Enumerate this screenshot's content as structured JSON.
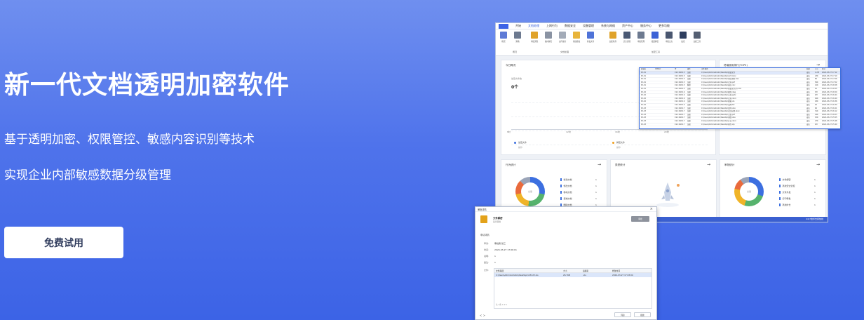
{
  "hero": {
    "title": "新一代文档透明加密软件",
    "subtitle1": "基于透明加密、权限管控、敏感内容识别等技术",
    "subtitle2": "实现企业内部敏感数据分级管理",
    "cta_label": "免费试用"
  },
  "app": {
    "menu": [
      "开始",
      "文档处理",
      "上网行为",
      "数据安全",
      "设备管理",
      "系统与网络",
      "资产中心",
      "服务中心",
      "更多功能"
    ],
    "active_menu": "文档处理",
    "ribbon_groups": [
      {
        "label": "概况",
        "items": [
          "概况",
          "策略"
        ]
      },
      {
        "label": "文档处理",
        "items": [
          "审批流程",
          "临时解密",
          "文件备份",
          "离线授权",
          "外发文件"
        ]
      },
      {
        "label": "加密工具",
        "items": [
          "加密软件",
          "安全通道",
          "审批管理",
          "批量解密",
          "审批日志",
          "加密",
          "加密工具"
        ]
      }
    ],
    "panel_today": {
      "title": "今日概况",
      "label": "加密文件数",
      "value": "0个",
      "xticks": [
        "8时",
        "12时",
        "16时",
        "20时"
      ],
      "legend": [
        {
          "label": "加密文件",
          "sub": "操作",
          "color": "#3c6fe0"
        },
        {
          "label": "解密文件",
          "sub": "操作",
          "color": "#f0a020"
        }
      ]
    },
    "panel_top": {
      "title": "终端使用排行(TOP5)"
    },
    "panel_behavior": {
      "title": "行为统计",
      "center": "总量",
      "items": [
        {
          "label": "新建文档",
          "value": "1",
          "color": "#3c6fe0"
        },
        {
          "label": "修改文档",
          "value": "1",
          "color": "#3c6fe0"
        },
        {
          "label": "移动文档",
          "value": "1",
          "color": "#3c6fe0"
        },
        {
          "label": "复制文档",
          "value": "1",
          "color": "#3c6fe0"
        },
        {
          "label": "删除文档",
          "value": "1",
          "color": "#3c6fe0"
        }
      ]
    },
    "panel_approval": {
      "title": "类型统计"
    },
    "panel_type": {
      "title": "审批统计",
      "center": "总量",
      "items": [
        {
          "label": "文件解密",
          "value": "1",
          "color": "#3c6fe0"
        },
        {
          "label": "离线安全管控",
          "value": "1",
          "color": "#3c6fe0"
        },
        {
          "label": "文件外发",
          "value": "1",
          "color": "#3c6fe0"
        },
        {
          "label": "打印审批",
          "value": "1",
          "color": "#3c6fe0"
        },
        {
          "label": "离线时长",
          "value": "1",
          "color": "#3c6fe0"
        }
      ]
    },
    "status_text": "24/7技术支持热线"
  },
  "overlay_table": {
    "headers": [
      "终端名",
      "IP/MAC",
      "IP",
      "操作",
      "文件路径",
      "结果",
      "大小",
      "时间"
    ],
    "rows": [
      [
        "PC-01",
        "",
        "192.168.0.5",
        "加密",
        "C:\\Users\\Administrator\\Desktop\\新建文件",
        "成功",
        "1.2M",
        "2024-03-27 17:12"
      ],
      [
        "PC-01",
        "",
        "192.168.0.5",
        "加密",
        "C:\\Users\\Administrator\\Desktop\\123.docx",
        "成功",
        "23K",
        "2024-03-27 17:10"
      ],
      [
        "PC-01",
        "",
        "192.168.0.5",
        "加密",
        "C:\\Users\\Administrator\\Desktop\\项目资料.xlsx",
        "成功",
        "8K",
        "2024-03-27 17:06"
      ],
      [
        "PC-01",
        "",
        "192.168.0.5",
        "加密",
        "C:\\Users\\Administrator\\Desktop\\合同.pdf",
        "成功",
        "56K",
        "2024-03-27 17:02"
      ],
      [
        "PC-01",
        "",
        "192.168.0.5",
        "解密",
        "C:\\Users\\Administrator\\Desktop\\报告.doc",
        "成功",
        "12K",
        "2024-03-27 16:58"
      ],
      [
        "PC-01",
        "",
        "192.168.0.5",
        "加密",
        "C:\\Users\\Administrator\\Desktop\\新建文件夹\\1.txt",
        "成功",
        "1K",
        "2024-03-27 16:55"
      ],
      [
        "PC-02",
        "",
        "192.168.0.6",
        "加密",
        "C:\\Users\\Administrator\\Desktop\\图纸.dwg",
        "成功",
        "3M",
        "2024-03-27 16:50"
      ],
      [
        "PC-02",
        "",
        "192.168.0.6",
        "加密",
        "C:\\Users\\Administrator\\Desktop\\方案.pptx",
        "成功",
        "2M",
        "2024-03-27 16:44"
      ],
      [
        "PC-02",
        "",
        "192.168.0.6",
        "加密",
        "C:\\Users\\Administrator\\Desktop\\文档.docx",
        "成功",
        "64K",
        "2024-03-27 16:40"
      ],
      [
        "PC-02",
        "",
        "192.168.0.6",
        "加密",
        "C:\\Users\\Administrator\\Desktop\\数据.xls",
        "成功",
        "18K",
        "2024-03-27 16:36"
      ],
      [
        "PC-02",
        "",
        "192.168.0.6",
        "加密",
        "C:\\Users\\Administrator\\Desktop\\说明.txt",
        "成功",
        "2K",
        "2024-03-27 16:30"
      ],
      [
        "PC-03",
        "",
        "192.168.0.7",
        "加密",
        "C:\\Users\\Administrator\\Desktop\\清单.xlsx",
        "成功",
        "9K",
        "2024-03-27 16:21"
      ],
      [
        "PC-03",
        "",
        "192.168.0.7",
        "加密",
        "C:\\Users\\Administrator\\Desktop\\会议纪要.docx",
        "成功",
        "31K",
        "2024-03-27 16:12"
      ],
      [
        "PC-03",
        "",
        "192.168.0.7",
        "加密",
        "C:\\Users\\Administrator\\Desktop\\计划.pdf",
        "成功",
        "44K",
        "2024-03-27 16:03"
      ],
      [
        "PC-03",
        "",
        "192.168.0.7",
        "加密",
        "C:\\Users\\Administrator\\Desktop\\预算.xlsx",
        "成功",
        "15K",
        "2024-03-27 15:55"
      ],
      [
        "PC-03",
        "",
        "192.168.0.7",
        "加密",
        "C:\\Users\\Administrator\\Desktop\\汇总.docx",
        "成功",
        "27K",
        "2024-03-27 15:48"
      ],
      [
        "PC-03",
        "",
        "192.168.0.7",
        "加密",
        "C:\\Users\\Administrator\\Desktop\\附件.zip",
        "成功",
        "4M",
        "2024-03-27 15:40"
      ]
    ]
  },
  "dialog": {
    "title": "审批详情",
    "file_name": "文件解密",
    "file_status": "等待审批",
    "action_label": "审批",
    "section": "申请详情",
    "fields": [
      {
        "label": "申请:",
        "value": "审批者 张三"
      },
      {
        "label": "时间:",
        "value": "2024-03-27 17:06:01"
      },
      {
        "label": "说明:",
        "value": "1"
      },
      {
        "label": "备注:",
        "value": "1"
      },
      {
        "label": "文件:",
        "value": ""
      }
    ],
    "table_headers": [
      "文件路径",
      "大小",
      "后缀名",
      "修改时间"
    ],
    "table_row": [
      "C:\\Users\\Administrator\\Desktop\\123123.xls",
      "26.7KB",
      ".xls",
      "2024-03-27 17:03:04"
    ],
    "pager": "共 1条  1 of 1",
    "ok_label": "同意",
    "reject_label": "拒绝",
    "nav_label": "< >"
  }
}
